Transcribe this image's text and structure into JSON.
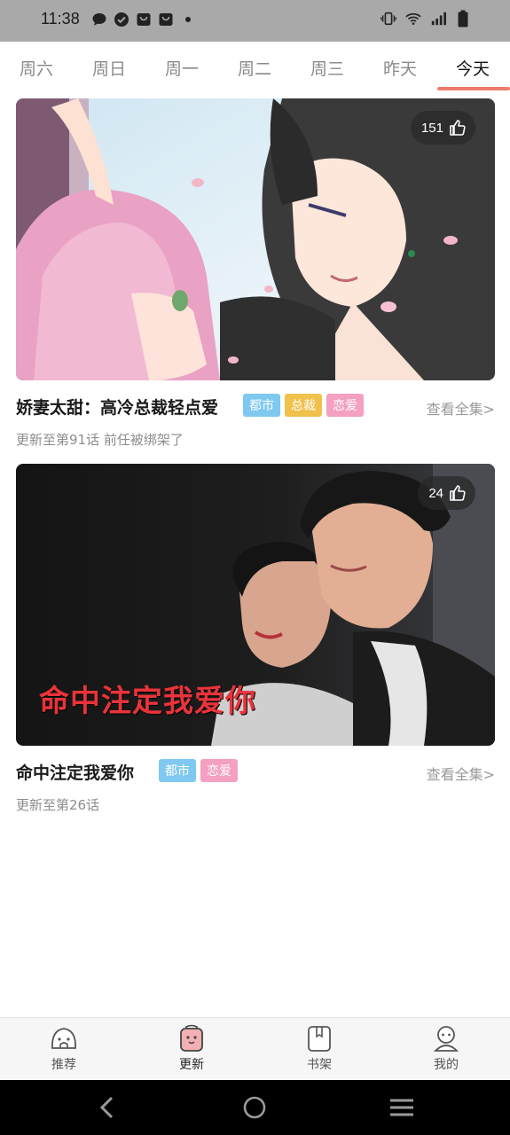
{
  "status_bar": {
    "time": "11:38",
    "left_icons": [
      "chat-bubble-icon",
      "check-circle-icon",
      "shopping-bag-icon",
      "shopping-bag-icon",
      "dot-icon"
    ],
    "right_icons": [
      "vibrate-icon",
      "wifi-icon",
      "signal-icon",
      "battery-icon"
    ]
  },
  "tabs": {
    "items": [
      {
        "label": "周六"
      },
      {
        "label": "周日"
      },
      {
        "label": "周一"
      },
      {
        "label": "周二"
      },
      {
        "label": "周三"
      },
      {
        "label": "昨天"
      },
      {
        "label": "今天"
      }
    ],
    "active_index": 6,
    "accent_color": "#f07a6a"
  },
  "cards": [
    {
      "likes": "151",
      "title": "娇妻太甜：高冷总裁轻点爱",
      "tags": [
        {
          "label": "都市",
          "color": "#7fc8f0"
        },
        {
          "label": "总裁",
          "color": "#f0c14b"
        },
        {
          "label": "恋爱",
          "color": "#f4a0c0"
        }
      ],
      "view_all": "查看全集>",
      "update": "更新至第91话 前任被绑架了"
    },
    {
      "likes": "24",
      "banner_text": "命中注定我爱你",
      "title": "命中注定我爱你",
      "tags": [
        {
          "label": "都市",
          "color": "#7fc8f0"
        },
        {
          "label": "恋爱",
          "color": "#f4a0c0"
        }
      ],
      "view_all": "查看全集>",
      "update": "更新至第26话"
    }
  ],
  "bottom_nav": {
    "items": [
      {
        "label": "推荐",
        "icon": "recommend-icon"
      },
      {
        "label": "更新",
        "icon": "update-bag-icon"
      },
      {
        "label": "书架",
        "icon": "bookshelf-icon"
      },
      {
        "label": "我的",
        "icon": "profile-icon"
      }
    ],
    "active_index": 1
  },
  "system_nav": [
    "back-icon",
    "home-icon",
    "recents-icon"
  ]
}
